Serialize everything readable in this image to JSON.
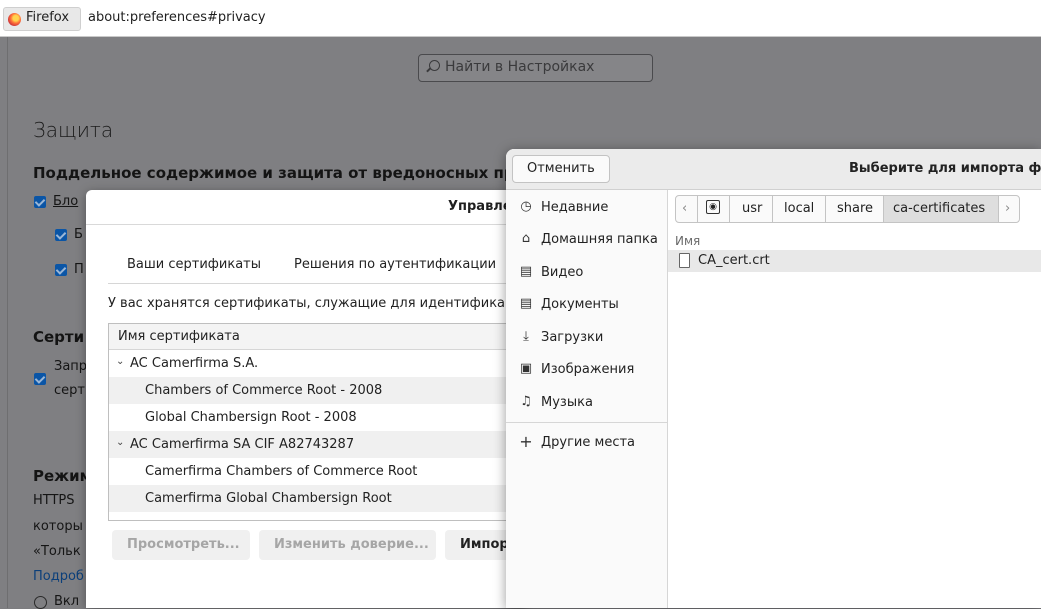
{
  "browser": {
    "tab_label": "Firefox",
    "url": "about:preferences#privacy"
  },
  "prefs": {
    "search_placeholder": "Найти в Настройках",
    "section_title": "Защита",
    "section_subtitle": "Поддельное содержимое и защита от вредоносных пр",
    "block_label": "Бло",
    "sub1_label": "Б",
    "sub2_label": "П",
    "certs_heading": "Серти",
    "certs_cb_line1": "Запр",
    "certs_cb_line2": "серт",
    "mode_heading": "Режим",
    "https_text": "HTTPS",
    "which_text": "которы",
    "only_text": "«Тольк",
    "more_link": "Подроб",
    "enable_label": "Вкл"
  },
  "cert_manager": {
    "title": "Управле",
    "tabs": [
      "Ваши сертификаты",
      "Решения по аутентификации"
    ],
    "description": "У вас хранятся сертификаты, служащие для идентификаци",
    "column_header": "Имя сертификата",
    "rows": [
      {
        "label": "AC Camerfirma S.A.",
        "group": true
      },
      {
        "label": "Chambers of Commerce Root - 2008",
        "group": false
      },
      {
        "label": "Global Chambersign Root - 2008",
        "group": false
      },
      {
        "label": "AC Camerfirma SA CIF A82743287",
        "group": true
      },
      {
        "label": "Camerfirma Chambers of Commerce Root",
        "group": false
      },
      {
        "label": "Camerfirma Global Chambersign Root",
        "group": false
      }
    ],
    "buttons": {
      "view": "Просмотреть...",
      "edit_trust": "Изменить доверие...",
      "import": "Импор"
    }
  },
  "file_chooser": {
    "cancel": "Отменить",
    "title": "Выберите для импорта фай",
    "places": [
      {
        "icon": "clock-icon",
        "label": "Недавние"
      },
      {
        "icon": "home-icon",
        "label": "Домашняя папка"
      },
      {
        "icon": "film-icon",
        "label": "Видео"
      },
      {
        "icon": "document-icon",
        "label": "Документы"
      },
      {
        "icon": "download-icon",
        "label": "Загрузки"
      },
      {
        "icon": "image-icon",
        "label": "Изображения"
      },
      {
        "icon": "music-icon",
        "label": "Музыка"
      }
    ],
    "other_places": "Другие места",
    "path": [
      "usr",
      "local",
      "share",
      "ca-certificates"
    ],
    "column_name": "Имя",
    "files": [
      "CA_cert.crt"
    ]
  }
}
